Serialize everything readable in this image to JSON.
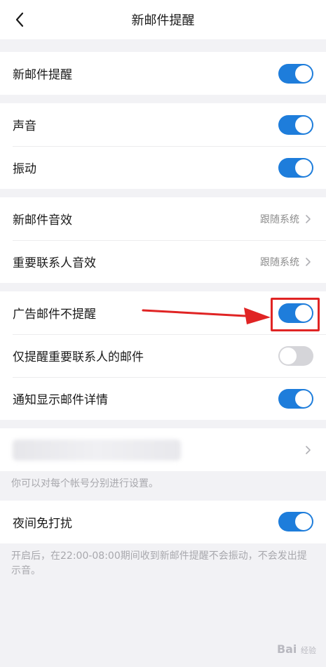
{
  "header": {
    "title": "新邮件提醒"
  },
  "group1": {
    "new_mail_alert": {
      "label": "新邮件提醒",
      "on": true
    }
  },
  "group2": {
    "sound": {
      "label": "声音",
      "on": true
    },
    "vibrate": {
      "label": "振动",
      "on": true
    }
  },
  "group3": {
    "new_mail_sound": {
      "label": "新邮件音效",
      "value": "跟随系统"
    },
    "vip_sound": {
      "label": "重要联系人音效",
      "value": "跟随系统"
    }
  },
  "group4": {
    "no_ad_alert": {
      "label": "广告邮件不提醒",
      "on": true
    },
    "vip_only": {
      "label": "仅提醒重要联系人的邮件",
      "on": false
    },
    "show_details": {
      "label": "通知显示邮件详情",
      "on": true
    }
  },
  "account_note": "你可以对每个帐号分别进行设置。",
  "night": {
    "label": "夜间免打扰",
    "on": true
  },
  "night_note": "开启后，在22:00-08:00期间收到新邮件提醒不会振动，不会发出提示音。",
  "watermark": {
    "brand": "Bai",
    "sub": "经验"
  },
  "colors": {
    "accent": "#1e7ddb",
    "highlight": "#e02424"
  }
}
